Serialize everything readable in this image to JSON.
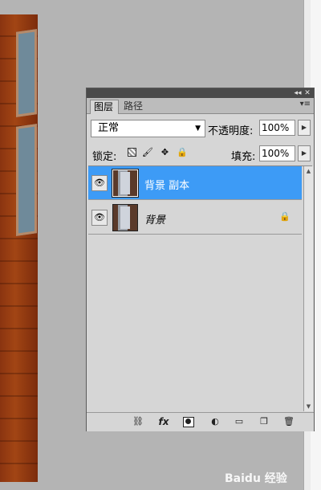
{
  "panel": {
    "topbar": {
      "collapse_icon": "◂◂",
      "close_icon": "✕"
    },
    "tabs": [
      {
        "label": "图层",
        "active": true
      },
      {
        "label": "路径",
        "active": false
      }
    ],
    "menu_icon": "▾≡",
    "blend_mode": "正常",
    "opacity_label": "不透明度:",
    "opacity_value": "100%",
    "lock_label": "锁定:",
    "fill_label": "填充:",
    "fill_value": "100%",
    "layers": [
      {
        "name": "背景 副本",
        "selected": true,
        "visible": true,
        "locked": false
      },
      {
        "name": "背景",
        "selected": false,
        "visible": true,
        "locked": true
      }
    ],
    "bottom_buttons": [
      "link-icon",
      "fx-icon",
      "mask-icon",
      "adjustment-icon",
      "group-folder-icon",
      "new-layer-icon",
      "trash-icon"
    ],
    "fx_label": "fx"
  },
  "watermark": "Baidu 经验",
  "colors": {
    "selected_row": "#3d9bf6",
    "panel_bg": "#d6d6d6",
    "workspace_bg": "#b4b4b4"
  }
}
